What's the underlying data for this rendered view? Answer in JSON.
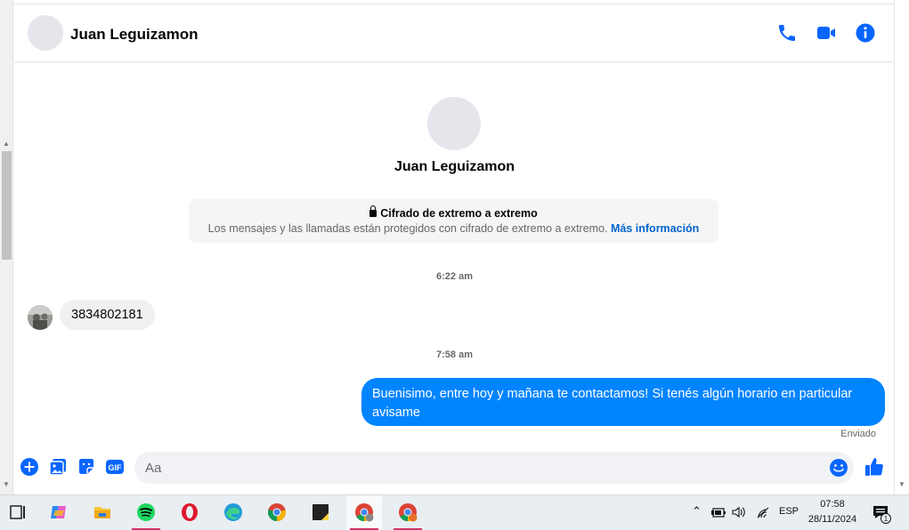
{
  "header": {
    "contact_name": "Juan Leguizamon",
    "icons": [
      "phone-icon",
      "video-call-icon",
      "info-icon"
    ]
  },
  "profile": {
    "name": "Juan Leguizamon"
  },
  "encryption_notice": {
    "title": "Cifrado de extremo a extremo",
    "description": "Los mensajes y las llamadas están protegidos con cifrado de extremo a extremo.",
    "link": "Más información"
  },
  "messages": [
    {
      "timestamp": "6:22 am",
      "direction": "incoming",
      "text": "3834802181"
    },
    {
      "timestamp": "7:58 am",
      "direction": "outgoing",
      "text": "Buenisimo, entre hoy y mañana te contactamos! Si tenés algún horario en particular avisame",
      "status": "Enviado"
    }
  ],
  "composer": {
    "placeholder": "Aa",
    "icons": [
      "plus-icon",
      "gallery-icon",
      "sticker-icon",
      "gif-icon",
      "emoji-icon",
      "like-icon"
    ],
    "gif_label": "GIF"
  },
  "colors": {
    "accent": "#0084ff",
    "link": "#0064d1",
    "icon_blue": "#0866ff"
  },
  "taskbar": {
    "apps": [
      "task-view-icon",
      "copilot-icon",
      "file-explorer-icon",
      "spotify-icon",
      "opera-icon",
      "edge-icon",
      "chrome-icon",
      "sticky-notes-icon",
      "chrome-profile-icon",
      "chrome-profile-2-icon"
    ],
    "language": "ESP",
    "time": "07:58",
    "date": "28/11/2024",
    "notification_count": "1"
  }
}
